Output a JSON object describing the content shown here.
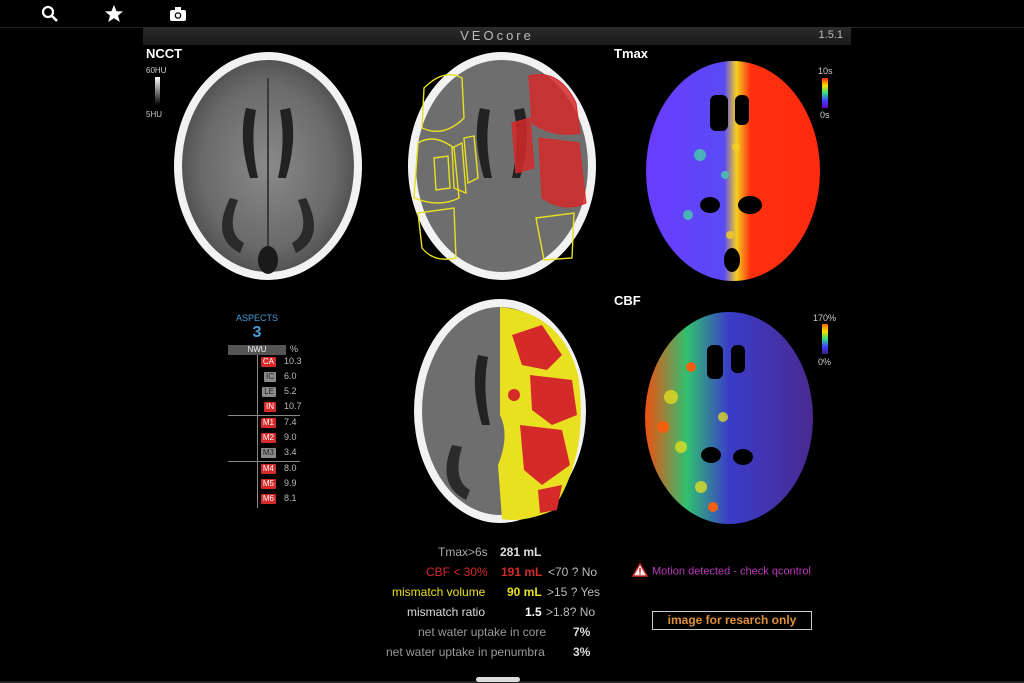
{
  "app": {
    "title": "VEOcore",
    "version": "1.5.1"
  },
  "toolbar": {
    "icons": [
      "search-icon",
      "star-icon",
      "camera-icon"
    ]
  },
  "panels": {
    "ncct": {
      "label": "NCCT",
      "scale_top": "60HU",
      "scale_bottom": "5HU"
    },
    "tmax": {
      "label": "Tmax",
      "scale_top": "10s",
      "scale_bottom": "0s"
    },
    "cbf": {
      "label": "CBF",
      "scale_top": "170%",
      "scale_bottom": "0%"
    }
  },
  "aspects": {
    "title": "ASPECTS",
    "score": "3",
    "header": "NWU",
    "pct_label": "%",
    "regions": [
      {
        "code": "CA",
        "value": "10.3",
        "affected": true
      },
      {
        "code": "IC",
        "value": "6.0",
        "affected": false
      },
      {
        "code": "LE",
        "value": "5.2",
        "affected": false
      },
      {
        "code": "IN",
        "value": "10.7",
        "affected": true
      },
      {
        "code": "M1",
        "value": "7.4",
        "affected": true
      },
      {
        "code": "M2",
        "value": "9.0",
        "affected": true
      },
      {
        "code": "M3",
        "value": "3.4",
        "affected": false
      },
      {
        "code": "M4",
        "value": "8.0",
        "affected": true
      },
      {
        "code": "M5",
        "value": "9.9",
        "affected": true
      },
      {
        "code": "M6",
        "value": "8.1",
        "affected": true
      }
    ]
  },
  "results": {
    "tmax": {
      "label": "Tmax>6s",
      "value": "281 mL"
    },
    "cbf": {
      "label": "CBF < 30%",
      "value": "191 mL",
      "check": "<70 ? No"
    },
    "mismatch_volume": {
      "label": "mismatch volume",
      "value": "90 mL",
      "check": ">15 ? Yes"
    },
    "mismatch_ratio": {
      "label": "mismatch ratio",
      "value": "1.5",
      "check": ">1.8? No"
    },
    "nwu_core": {
      "label": "net water uptake in core",
      "value": "7%"
    },
    "nwu_penumbra": {
      "label": "net water uptake in penumbra",
      "value": "3%"
    }
  },
  "warning": {
    "text": "Motion detected  - check qcontrol"
  },
  "disclaimer": {
    "text": "image for resarch only"
  },
  "colors": {
    "red": "#d42a2a",
    "yellow": "#e8e020",
    "blue_text": "#4a9bd8",
    "magenta": "#b93bb9",
    "orange": "#e0903a"
  }
}
